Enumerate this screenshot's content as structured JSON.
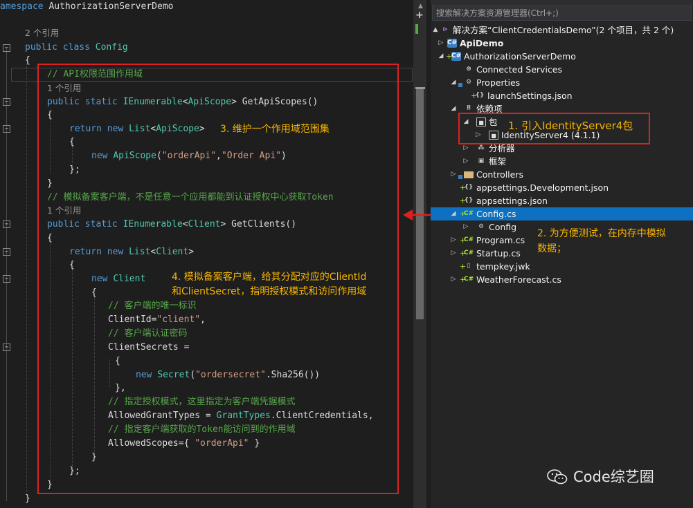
{
  "editor": {
    "lines": [
      {
        "segs": [
          [
            "amespace ",
            "kw"
          ],
          [
            "AuthorizationServerDemo",
            "fn"
          ]
        ]
      },
      {
        "segs": []
      },
      {
        "segs": [
          [
            "2 个引用",
            "ref"
          ]
        ]
      },
      {
        "segs": [
          [
            "public ",
            "kw"
          ],
          [
            "class ",
            "kw"
          ],
          [
            "Config",
            "ty"
          ]
        ]
      },
      {
        "segs": [
          [
            "{",
            "fn"
          ]
        ]
      },
      {
        "segs": [
          [
            "// API权限范围作用域",
            "cm"
          ]
        ]
      },
      {
        "segs": [
          [
            "1 个引用",
            "ref"
          ]
        ]
      },
      {
        "segs": [
          [
            "public ",
            "kw"
          ],
          [
            "static ",
            "kw"
          ],
          [
            "IEnumerable",
            "ty"
          ],
          [
            "<",
            "fn"
          ],
          [
            "ApiScope",
            "ty"
          ],
          [
            "> GetApiScopes()",
            "fn"
          ]
        ]
      },
      {
        "segs": [
          [
            "{",
            "fn"
          ]
        ]
      },
      {
        "segs": [
          [
            "return ",
            "kw"
          ],
          [
            "new ",
            "kw"
          ],
          [
            "List",
            "ty"
          ],
          [
            "<",
            "fn"
          ],
          [
            "ApiScope",
            "ty"
          ],
          [
            ">",
            "fn"
          ]
        ]
      },
      {
        "segs": [
          [
            "{",
            "fn"
          ]
        ]
      },
      {
        "segs": [
          [
            "new ",
            "kw"
          ],
          [
            "ApiScope",
            "ty"
          ],
          [
            "(",
            "fn"
          ],
          [
            "\"orderApi\"",
            "str"
          ],
          [
            ",",
            "fn"
          ],
          [
            "\"Order Api\"",
            "str"
          ],
          [
            ")",
            "fn"
          ]
        ]
      },
      {
        "segs": [
          [
            "};",
            "fn"
          ]
        ]
      },
      {
        "segs": [
          [
            "}",
            "fn"
          ]
        ]
      },
      {
        "segs": [
          [
            "// 模拟备案客户端，不是任意一个应用都能到认证授权中心获取Token",
            "cm"
          ]
        ]
      },
      {
        "segs": [
          [
            "1 个引用",
            "ref"
          ]
        ]
      },
      {
        "segs": [
          [
            "public ",
            "kw"
          ],
          [
            "static ",
            "kw"
          ],
          [
            "IEnumerable",
            "ty"
          ],
          [
            "<",
            "fn"
          ],
          [
            "Client",
            "ty"
          ],
          [
            "> GetClients()",
            "fn"
          ]
        ]
      },
      {
        "segs": [
          [
            "{",
            "fn"
          ]
        ]
      },
      {
        "segs": [
          [
            "return ",
            "kw"
          ],
          [
            "new ",
            "kw"
          ],
          [
            "List",
            "ty"
          ],
          [
            "<",
            "fn"
          ],
          [
            "Client",
            "ty"
          ],
          [
            ">",
            "fn"
          ]
        ]
      },
      {
        "segs": [
          [
            "{",
            "fn"
          ]
        ]
      },
      {
        "segs": [
          [
            "new ",
            "kw"
          ],
          [
            "Client",
            "ty"
          ]
        ]
      },
      {
        "segs": [
          [
            "{",
            "fn"
          ]
        ]
      },
      {
        "segs": [
          [
            "// 客户端的唯一标识",
            "cm"
          ]
        ]
      },
      {
        "segs": [
          [
            "ClientId=",
            "fn"
          ],
          [
            "\"client\"",
            "str"
          ],
          [
            ",",
            "fn"
          ]
        ]
      },
      {
        "segs": [
          [
            "// 客户端认证密码",
            "cm"
          ]
        ]
      },
      {
        "segs": [
          [
            "ClientSecrets =",
            "fn"
          ]
        ]
      },
      {
        "segs": [
          [
            "{",
            "fn"
          ]
        ]
      },
      {
        "segs": [
          [
            "new ",
            "kw"
          ],
          [
            "Secret",
            "ty"
          ],
          [
            "(",
            "fn"
          ],
          [
            "\"ordersecret\"",
            "str"
          ],
          [
            ".Sha256())",
            "fn"
          ]
        ]
      },
      {
        "segs": [
          [
            "},",
            "fn"
          ]
        ]
      },
      {
        "segs": [
          [
            "// 指定授权模式，这里指定为客户端凭据模式",
            "cm"
          ]
        ]
      },
      {
        "segs": [
          [
            "AllowedGrantTypes = ",
            "fn"
          ],
          [
            "GrantTypes",
            "ty"
          ],
          [
            ".ClientCredentials,",
            "fn"
          ]
        ]
      },
      {
        "segs": [
          [
            "// 指定客户端获取的Token能访问到的作用域",
            "cm"
          ]
        ]
      },
      {
        "segs": [
          [
            "AllowedScopes={ ",
            "fn"
          ],
          [
            "\"orderApi\"",
            "str"
          ],
          [
            " }",
            "fn"
          ]
        ]
      },
      {
        "segs": [
          [
            "}",
            "fn"
          ]
        ]
      },
      {
        "segs": [
          [
            "};",
            "fn"
          ]
        ]
      },
      {
        "segs": [
          [
            "}",
            "fn"
          ]
        ]
      },
      {
        "segs": [
          [
            "}",
            "fn"
          ]
        ]
      }
    ]
  },
  "annotations": {
    "note1": "1. 引入IdentityServer4包",
    "note2_line1": "2. 为方便测试，在内存中模拟",
    "note2_line2": "数据；",
    "note3": "3. 维护一个作用域范围集",
    "note4_line1": "4. 模拟备案客户端，给其分配对应的ClientId",
    "note4_line2": "和ClientSecret，指明授权模式和访问作用域"
  },
  "explorer": {
    "search_placeholder": "搜索解决方案资源管理器(Ctrl+;)",
    "rows": [
      {
        "label": "解决方案“ClientCredentialsDemo”(2 个项目，共 2 个)",
        "icon": "solution-icon"
      },
      {
        "label": "ApiDemo",
        "icon": "csharp-project-icon"
      },
      {
        "label": "AuthorizationServerDemo",
        "icon": "csharp-project-icon"
      },
      {
        "label": "Connected Services",
        "icon": "connected-services-icon"
      },
      {
        "label": "Properties",
        "icon": "properties-icon"
      },
      {
        "label": "launchSettings.json",
        "icon": "json-file-icon"
      },
      {
        "label": "依赖项",
        "icon": "dependencies-icon"
      },
      {
        "label": "包",
        "icon": "package-icon"
      },
      {
        "label": "IdentityServer4 (4.1.1)",
        "icon": "package-icon"
      },
      {
        "label": "分析器",
        "icon": "analyzer-icon"
      },
      {
        "label": "框架",
        "icon": "framework-icon"
      },
      {
        "label": "Controllers",
        "icon": "folder-icon"
      },
      {
        "label": "appsettings.Development.json",
        "icon": "json-file-icon"
      },
      {
        "label": "appsettings.json",
        "icon": "json-file-icon"
      },
      {
        "label": "Config.cs",
        "icon": "csharp-file-icon"
      },
      {
        "label": "Config",
        "icon": "class-icon"
      },
      {
        "label": "Program.cs",
        "icon": "csharp-file-icon"
      },
      {
        "label": "Startup.cs",
        "icon": "csharp-file-icon"
      },
      {
        "label": "tempkey.jwk",
        "icon": "file-icon"
      },
      {
        "label": "WeatherForecast.cs",
        "icon": "csharp-file-icon"
      }
    ]
  },
  "watermark": "Code综艺圈",
  "colors": {
    "annotation_box": "#e02020",
    "annotation_text": "#f5b400",
    "selection": "#0e70c0"
  }
}
